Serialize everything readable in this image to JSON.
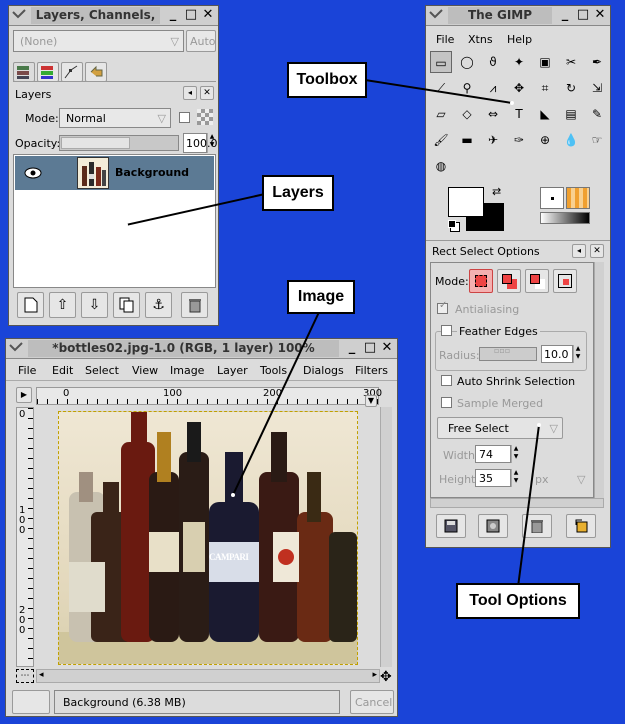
{
  "layers_window": {
    "title": "Layers, Channels,",
    "image_select": "(None)",
    "auto_button": "Auto",
    "panel_title": "Layers",
    "mode_label": "Mode:",
    "mode_value": "Normal",
    "opacity_label": "Opacity:",
    "opacity_value": "100.0",
    "layer_name": "Background"
  },
  "toolbox_window": {
    "title": "The GIMP",
    "menu": [
      "File",
      "Xtns",
      "Help"
    ],
    "tools": [
      "rect-select",
      "ellipse-select",
      "free-select",
      "fuzzy-select",
      "color-select",
      "scissors",
      "paths",
      "color-picker",
      "zoom",
      "measure",
      "move",
      "crop",
      "rotate",
      "scale",
      "shear",
      "perspective",
      "flip",
      "text",
      "bucket-fill",
      "blend",
      "pencil",
      "paintbrush",
      "eraser",
      "airbrush",
      "ink",
      "clone",
      "convolve",
      "smudge",
      "dodge-burn"
    ],
    "options_title": "Rect Select Options",
    "mode_label": "Mode:",
    "antialiasing": "Antialiasing",
    "feather_edges": "Feather Edges",
    "radius_label": "Radius:",
    "radius_value": "10.0",
    "auto_shrink": "Auto Shrink Selection",
    "sample_merged": "Sample Merged",
    "free_select": "Free Select",
    "width_label": "Width:",
    "width_value": "74",
    "height_label": "Height:",
    "height_value": "35",
    "unit_value": "px"
  },
  "image_window": {
    "title": "*bottles02.jpg-1.0 (RGB, 1 layer) 100%",
    "menu": [
      "File",
      "Edit",
      "Select",
      "View",
      "Image",
      "Layer",
      "Tools",
      "Dialogs",
      "Filters"
    ],
    "ruler_ticks": [
      "0",
      "100",
      "200",
      "300"
    ],
    "vruler_ticks": [
      "0",
      "1\n0\n0",
      "2\n0\n0"
    ],
    "status": "Background (6.38 MB)",
    "cancel": "Cancel",
    "bottle_label": "CAMPARI"
  },
  "callouts": {
    "toolbox": "Toolbox",
    "layers": "Layers",
    "image": "Image",
    "tool_options": "Tool Options"
  },
  "colors": {
    "desktop": "#1a44d8",
    "layer_selected": "#5c7a94"
  }
}
